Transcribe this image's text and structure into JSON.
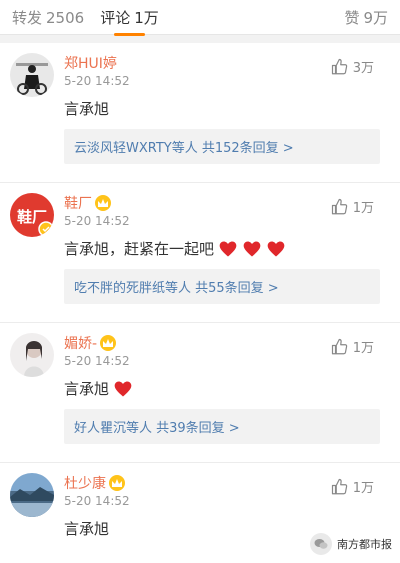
{
  "tabs": {
    "repost_label": "转发",
    "repost_count": "2506",
    "comment_label": "评论",
    "comment_count": "1万",
    "like_label": "赞",
    "like_count": "9万"
  },
  "accent_color": "#ff8200",
  "name_color": "#eb7350",
  "link_color": "#507daf",
  "comments": [
    {
      "name": "郑HUI婷",
      "time": "5-20 14:52",
      "text": "言承旭",
      "hearts": 0,
      "likes": "3万",
      "replies": "云淡风轻WXRTY等人  共152条回复 >",
      "vip": false
    },
    {
      "name": "鞋厂",
      "time": "5-20 14:52",
      "text": "言承旭，赶紧在一起吧",
      "hearts": 3,
      "likes": "1万",
      "replies": "吃不胖的死胖纸等人  共55条回复 >",
      "vip": true
    },
    {
      "name": "媚娇-",
      "time": "5-20 14:52",
      "text": "言承旭",
      "hearts": 1,
      "likes": "1万",
      "replies": "好人瞿沉等人  共39条回复 >",
      "vip": true
    },
    {
      "name": "杜少康",
      "time": "5-20 14:52",
      "text": "言承旭",
      "hearts": 0,
      "likes": "1万",
      "vip": true
    }
  ],
  "avatar_badge_text": "鞋厂",
  "watermark": "南方都市报"
}
